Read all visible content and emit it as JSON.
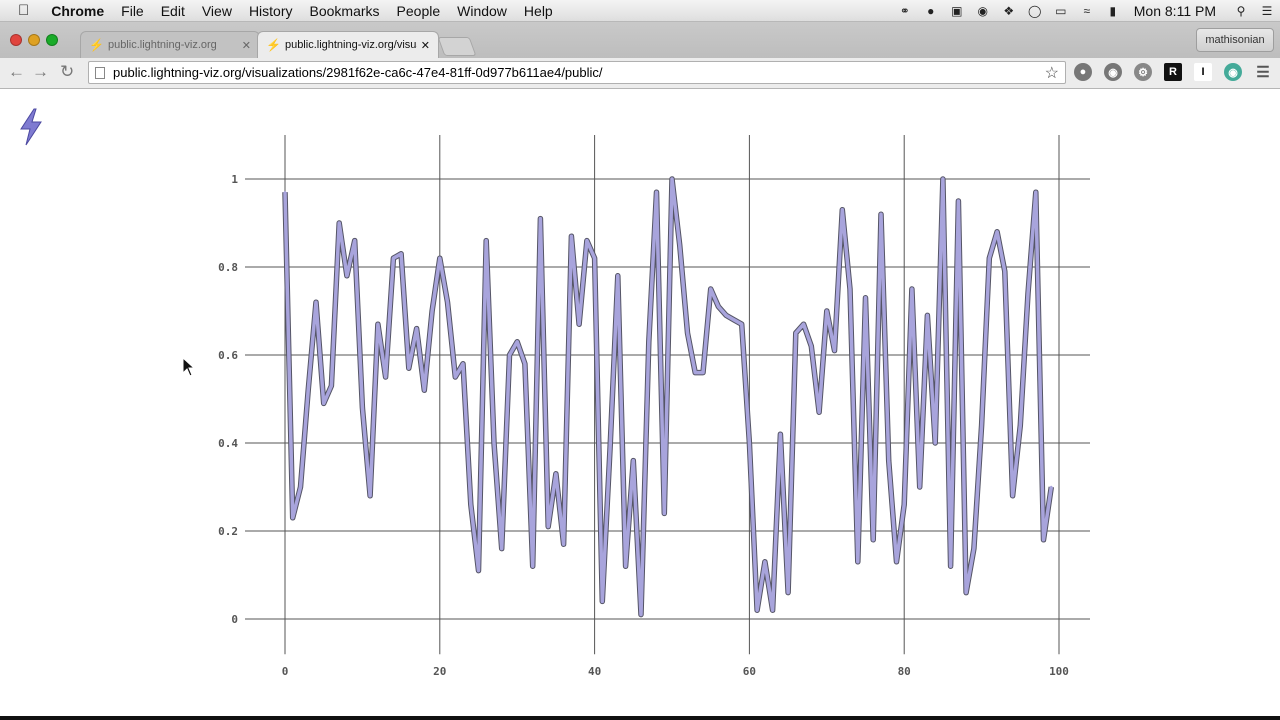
{
  "menubar": {
    "apple": "",
    "app_name": "Chrome",
    "menus": [
      "File",
      "Edit",
      "View",
      "History",
      "Bookmarks",
      "People",
      "Window",
      "Help"
    ],
    "clock": "Mon 8:11 PM"
  },
  "tabs": [
    {
      "title": "public.lightning-viz.org",
      "active": false
    },
    {
      "title": "public.lightning-viz.org/visua",
      "active": true
    }
  ],
  "profile_name": "mathisonian",
  "toolbar": {
    "url": "public.lightning-viz.org/visualizations/2981f62e-ca6c-47e4-81ff-0d977b611ae4/public/"
  },
  "extensions": [
    "R",
    "I"
  ],
  "colors": {
    "line": "#a8a4dc",
    "line_edge": "#555566",
    "grid": "#555555",
    "logo": "#7f7bd1"
  },
  "chart_data": {
    "type": "line",
    "x": [
      0,
      1,
      2,
      3,
      4,
      5,
      6,
      7,
      8,
      9,
      10,
      11,
      12,
      13,
      14,
      15,
      16,
      17,
      18,
      19,
      20,
      21,
      22,
      23,
      24,
      25,
      26,
      27,
      28,
      29,
      30,
      31,
      32,
      33,
      34,
      35,
      36,
      37,
      38,
      39,
      40,
      41,
      42,
      43,
      44,
      45,
      46,
      47,
      48,
      49,
      50,
      51,
      52,
      53,
      54,
      55,
      56,
      57,
      58,
      59,
      60,
      61,
      62,
      63,
      64,
      65,
      66,
      67,
      68,
      69,
      70,
      71,
      72,
      73,
      74,
      75,
      76,
      77,
      78,
      79,
      80,
      81,
      82,
      83,
      84,
      85,
      86,
      87,
      88,
      89,
      90,
      91,
      92,
      93,
      94,
      95,
      96,
      97,
      98,
      99
    ],
    "series": [
      {
        "values": [
          0.97,
          0.23,
          0.3,
          0.52,
          0.72,
          0.49,
          0.53,
          0.9,
          0.78,
          0.86,
          0.48,
          0.28,
          0.67,
          0.55,
          0.82,
          0.83,
          0.57,
          0.66,
          0.52,
          0.7,
          0.82,
          0.72,
          0.55,
          0.58,
          0.26,
          0.11,
          0.86,
          0.4,
          0.16,
          0.6,
          0.63,
          0.58,
          0.12,
          0.91,
          0.21,
          0.33,
          0.17,
          0.87,
          0.67,
          0.86,
          0.82,
          0.04,
          0.39,
          0.78,
          0.12,
          0.36,
          0.01,
          0.63,
          0.97,
          0.24,
          1.0,
          0.85,
          0.65,
          0.56,
          0.56,
          0.75,
          0.71,
          0.69,
          0.68,
          0.67,
          0.4,
          0.02,
          0.13,
          0.02,
          0.42,
          0.06,
          0.65,
          0.67,
          0.62,
          0.47,
          0.7,
          0.61,
          0.93,
          0.75,
          0.13,
          0.73,
          0.18,
          0.92,
          0.36,
          0.13,
          0.26,
          0.75,
          0.3,
          0.69,
          0.4,
          1.0,
          0.12,
          0.95,
          0.06,
          0.16,
          0.44,
          0.82,
          0.88,
          0.79,
          0.28,
          0.44,
          0.74,
          0.97,
          0.18,
          0.3
        ]
      }
    ],
    "xlim": [
      0,
      100
    ],
    "ylim": [
      -0.08,
      1.1
    ],
    "xticks": [
      0,
      20,
      40,
      60,
      80,
      100
    ],
    "yticks": [
      0,
      0.2,
      0.4,
      0.6,
      0.8,
      1
    ],
    "xtick_labels": [
      "0",
      "20",
      "40",
      "60",
      "80",
      "100"
    ],
    "ytick_labels": [
      "0",
      "0.2",
      "0.4",
      "0.6",
      "0.8",
      "1"
    ],
    "grid": true,
    "title": "",
    "xlabel": "",
    "ylabel": ""
  }
}
